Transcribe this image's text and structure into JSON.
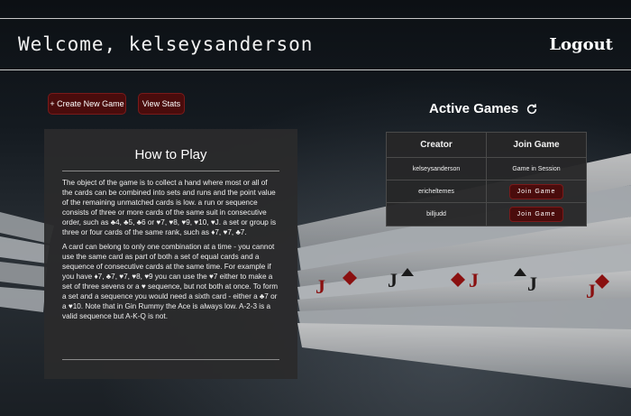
{
  "header": {
    "welcome_prefix": "Welcome, ",
    "username": "kelseysanderson",
    "logout_label": "Logout"
  },
  "actions": {
    "create_label": "+ Create New Game",
    "stats_label": "View Stats"
  },
  "how_to_play": {
    "title": "How to Play",
    "paragraph1": "The object of the game is to collect a hand where most or all of the cards can be combined into sets and runs and the point value of the remaining unmatched cards is low. a run or sequence consists of three or more cards of the same suit in consecutive order, such as ♣4, ♣5, ♣6 or ♥7, ♥8, ♥9, ♥10, ♥J. a set or group is three or four cards of the same rank, such as ♦7, ♥7, ♣7.",
    "paragraph2": "A card can belong to only one combination at a time - you cannot use the same card as part of both a set of equal cards and a sequence of consecutive cards at the same time. For example if you have ♦7, ♣7, ♥7, ♥8, ♥9 you can use the ♥7 either to make a set of three sevens or a ♥ sequence, but not both at once. To form a set and a sequence you would need a sixth card - either a ♣7 or a ♥10. Note that in Gin Rummy the Ace is always low. A-2-3 is a valid sequence but A-K-Q is not."
  },
  "active_games": {
    "title": "Active Games",
    "refresh_icon": "refresh-icon",
    "columns": [
      "Creator",
      "Join Game"
    ],
    "rows": [
      {
        "creator": "kelseysanderson",
        "status": "Game in Session"
      },
      {
        "creator": "ericheltemes",
        "action": "Join Game"
      },
      {
        "creator": "billjudd",
        "action": "Join Game"
      }
    ]
  },
  "colors": {
    "button_bg": "#4a0c0c",
    "panel_bg": "#2a2a2c"
  }
}
